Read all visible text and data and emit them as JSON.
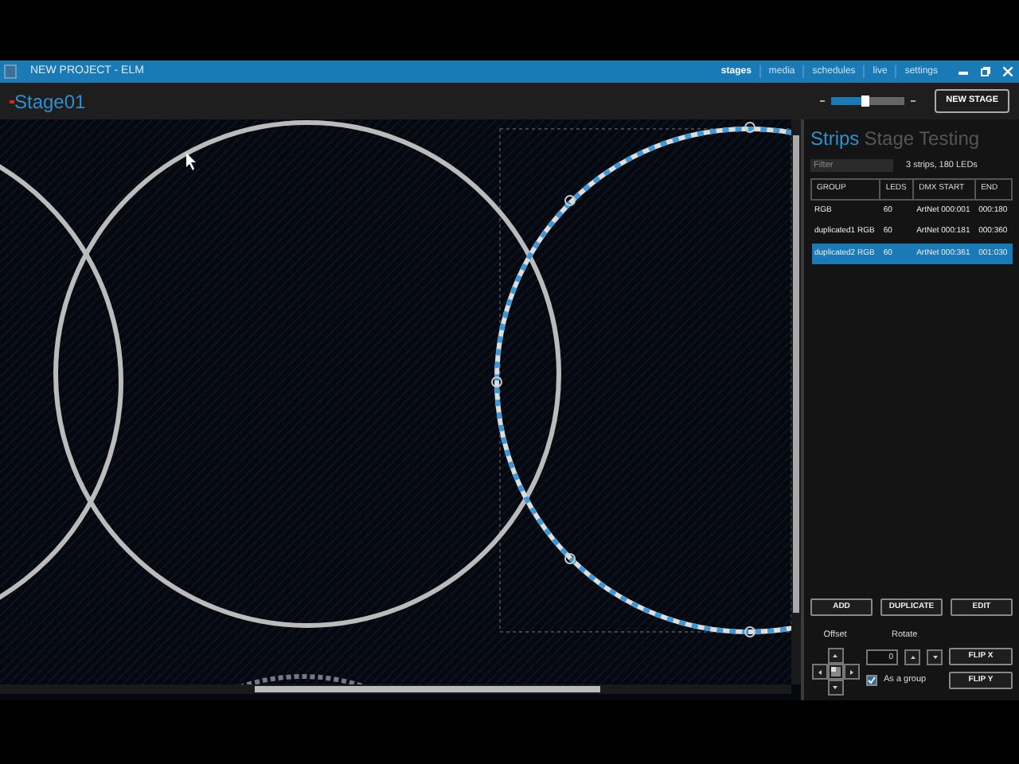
{
  "window": {
    "title": "NEW PROJECT - ELM"
  },
  "nav": [
    {
      "label": "stages",
      "selected": true
    },
    {
      "label": "media",
      "selected": false
    },
    {
      "label": "schedules",
      "selected": false
    },
    {
      "label": "live",
      "selected": false
    },
    {
      "label": "settings",
      "selected": false
    }
  ],
  "stage": {
    "title": "Stage01",
    "zoom": {
      "level": 0.45
    },
    "new_stage_button": "NEW STAGE"
  },
  "panel_tabs": [
    {
      "label": "Strips",
      "selected": true
    },
    {
      "label": "Stage",
      "selected": false
    },
    {
      "label": "Testing",
      "selected": false
    }
  ],
  "filter": {
    "placeholder": "Filter"
  },
  "summary": "3 strips, 180 LEDs",
  "table": {
    "columns": [
      "GROUP",
      "LEDS",
      "DMX START",
      "END"
    ],
    "rows": [
      {
        "cells": [
          "RGB",
          "60",
          "ArtNet 000:001",
          "000:180"
        ],
        "selected": false
      },
      {
        "cells": [
          "duplicated1 RGB",
          "60",
          "ArtNet 000:181",
          "000:360"
        ],
        "selected": false
      },
      {
        "cells": [
          "duplicated2 RGB",
          "60",
          "ArtNet 000:361",
          "001:030"
        ],
        "selected": true
      }
    ]
  },
  "actions": [
    "ADD",
    "DUPLICATE",
    "EDIT"
  ],
  "offset_label": "Offset",
  "rotate": {
    "label": "Rotate",
    "value": "0"
  },
  "as_group": {
    "label": "As a group",
    "checked": true
  },
  "flip_buttons": [
    "FLIP X",
    "FLIP Y"
  ]
}
